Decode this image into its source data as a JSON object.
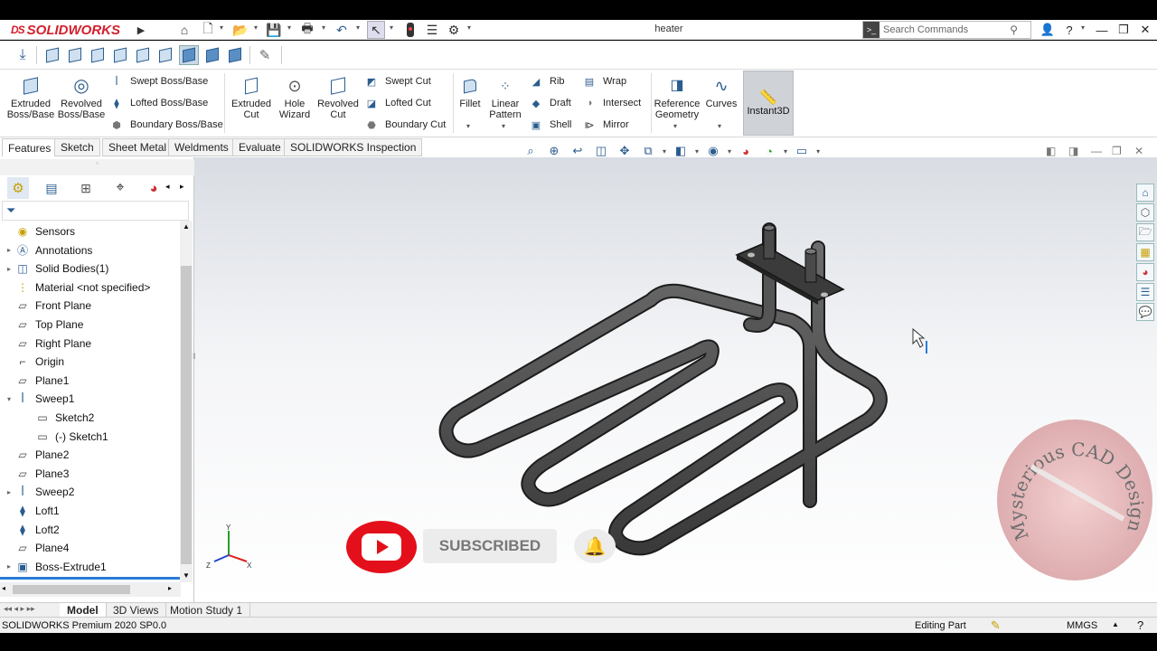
{
  "app": {
    "brand": "SOLIDWORKS",
    "doc_title": "heater"
  },
  "search": {
    "placeholder": "Search Commands"
  },
  "ribbon": {
    "extruded_boss": "Extruded\nBoss/Base",
    "revolved_boss": "Revolved\nBoss/Base",
    "swept_boss": "Swept Boss/Base",
    "lofted_boss": "Lofted Boss/Base",
    "boundary_boss": "Boundary Boss/Base",
    "extruded_cut": "Extruded\nCut",
    "hole_wizard": "Hole\nWizard",
    "revolved_cut": "Revolved\nCut",
    "swept_cut": "Swept Cut",
    "lofted_cut": "Lofted Cut",
    "boundary_cut": "Boundary Cut",
    "fillet": "Fillet",
    "linear_pattern": "Linear\nPattern",
    "rib": "Rib",
    "draft": "Draft",
    "shell": "Shell",
    "wrap": "Wrap",
    "intersect": "Intersect",
    "mirror": "Mirror",
    "reference_geometry": "Reference\nGeometry",
    "curves": "Curves",
    "instant3d": "Instant3D"
  },
  "tabs": [
    "Features",
    "Sketch",
    "Sheet Metal",
    "Weldments",
    "Evaluate",
    "SOLIDWORKS Inspection"
  ],
  "tree": [
    {
      "label": "Sensors",
      "icon": "sensor-icon",
      "expand": false
    },
    {
      "label": "Annotations",
      "icon": "annotations-icon",
      "expand": true
    },
    {
      "label": "Solid Bodies(1)",
      "icon": "solid-bodies-icon",
      "expand": true
    },
    {
      "label": "Material <not specified>",
      "icon": "material-icon",
      "expand": false
    },
    {
      "label": "Front Plane",
      "icon": "plane-icon",
      "expand": false
    },
    {
      "label": "Top Plane",
      "icon": "plane-icon",
      "expand": false
    },
    {
      "label": "Right Plane",
      "icon": "plane-icon",
      "expand": false
    },
    {
      "label": "Origin",
      "icon": "origin-icon",
      "expand": false
    },
    {
      "label": "Plane1",
      "icon": "plane-icon",
      "expand": false
    },
    {
      "label": "Sweep1",
      "icon": "sweep-icon",
      "expand": "open"
    },
    {
      "label": "Sketch2",
      "icon": "sketch-icon",
      "expand": false,
      "indent": true
    },
    {
      "label": "(-) Sketch1",
      "icon": "sketch-icon",
      "expand": false,
      "indent": true
    },
    {
      "label": "Plane2",
      "icon": "plane-icon",
      "expand": false
    },
    {
      "label": "Plane3",
      "icon": "plane-icon",
      "expand": false
    },
    {
      "label": "Sweep2",
      "icon": "sweep-icon",
      "expand": true
    },
    {
      "label": "Loft1",
      "icon": "loft-icon",
      "expand": false
    },
    {
      "label": "Loft2",
      "icon": "loft-icon",
      "expand": false
    },
    {
      "label": "Plane4",
      "icon": "plane-icon",
      "expand": false
    },
    {
      "label": "Boss-Extrude1",
      "icon": "extrude-icon",
      "expand": true
    }
  ],
  "bottom_tabs": [
    "Model",
    "3D Views",
    "Motion Study 1"
  ],
  "status": {
    "version": "SOLIDWORKS Premium 2020 SP0.0",
    "mode": "Editing Part",
    "units": "MMGS"
  },
  "overlay": {
    "subscribe": "SUBSCRIBED",
    "watermark": "Mysterious CAD Design"
  },
  "triad": {
    "x": "X",
    "y": "Y",
    "z": "Z"
  },
  "colors": {
    "brand_red": "#d41f2d",
    "accent_blue": "#2b5d8f",
    "youtube_red": "#e3101b"
  }
}
